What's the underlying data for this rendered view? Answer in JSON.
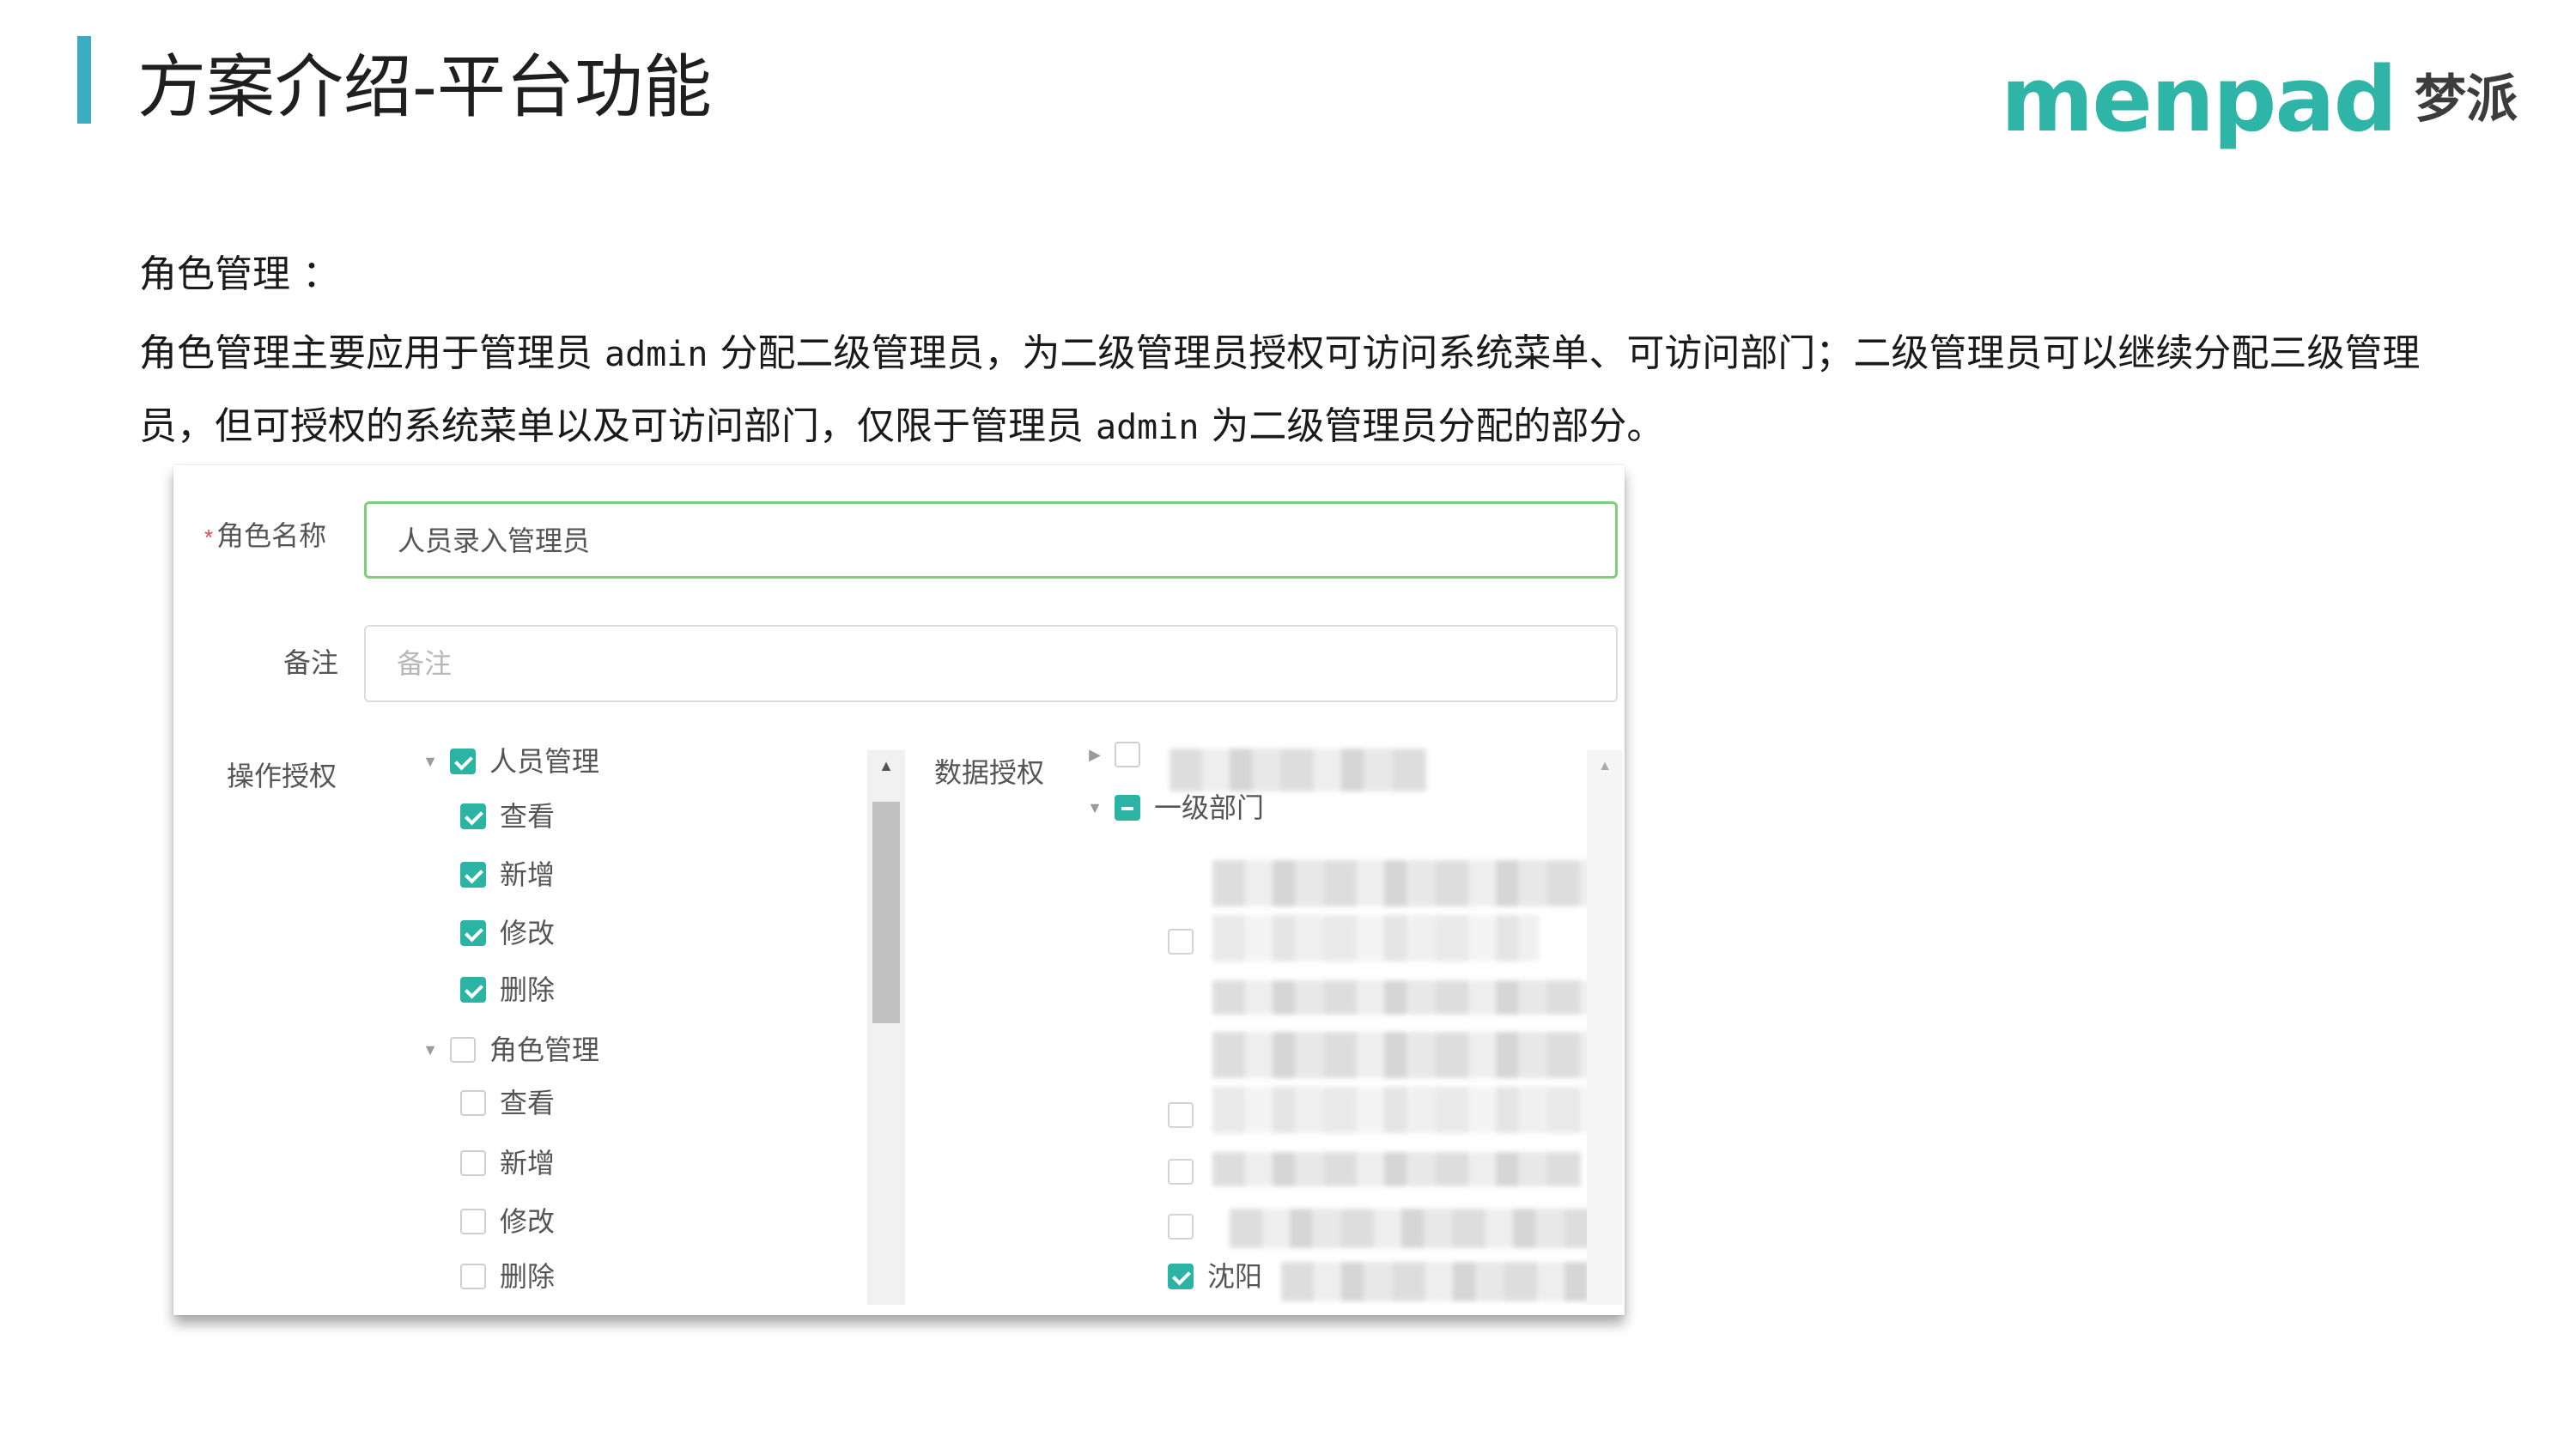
{
  "header": {
    "title": "方案介绍-平台功能",
    "logo_word": "menpad",
    "logo_cn": "梦派"
  },
  "intro": {
    "section_label": "角色管理 ：",
    "desc_part1": "角色管理主要应用于管理员 ",
    "desc_admin1": "admin",
    "desc_part2": " 分配二级管理员，为二级管理员授权可访问系统菜单、可访问部门；二级管理员可以继续分配三级管理员，但可授权的系统菜单以及可访问部门，仅限于管理员 ",
    "desc_admin2": "admin",
    "desc_part3": " 为二级管理员分配的部分。"
  },
  "form": {
    "role_name_label": "角色名称",
    "required_mark": "*",
    "role_name_value": "人员录入管理员",
    "remark_label": "备注",
    "remark_placeholder": "备注",
    "op_auth_label": "操作授权",
    "data_auth_label": "数据授权"
  },
  "op_tree": [
    {
      "label": "人员管理",
      "level": 0,
      "state": "checked",
      "expanded": true
    },
    {
      "label": "查看",
      "level": 1,
      "state": "checked"
    },
    {
      "label": "新增",
      "level": 1,
      "state": "checked"
    },
    {
      "label": "修改",
      "level": 1,
      "state": "checked"
    },
    {
      "label": "删除",
      "level": 1,
      "state": "checked"
    },
    {
      "label": "角色管理",
      "level": 0,
      "state": "unchecked",
      "expanded": true
    },
    {
      "label": "查看",
      "level": 1,
      "state": "unchecked"
    },
    {
      "label": "新增",
      "level": 1,
      "state": "unchecked"
    },
    {
      "label": "修改",
      "level": 1,
      "state": "unchecked"
    },
    {
      "label": "删除",
      "level": 1,
      "state": "unchecked"
    }
  ],
  "data_tree": {
    "level1_label": "一级部门",
    "checked_leaf_label": "沈阳"
  },
  "colors": {
    "accent_bar": "#3aaec0",
    "logo_teal": "#2fb4a8",
    "checkbox_teal": "#2bb3a3",
    "focus_border": "#7cd07a",
    "required_red": "#e04b4b"
  },
  "icons": [
    "caret-down-icon",
    "caret-right-icon",
    "check-icon",
    "scroll-up-arrow-icon"
  ]
}
